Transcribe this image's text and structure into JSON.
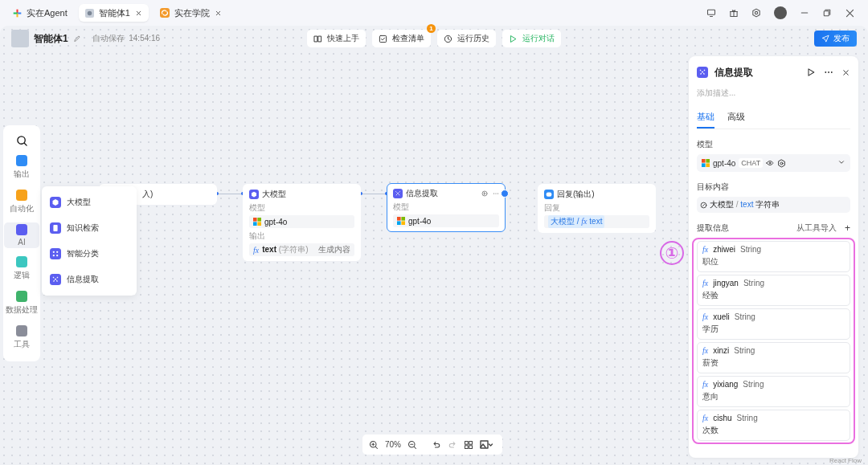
{
  "tabs": [
    {
      "label": "实在Agent",
      "selected": false,
      "closable": false,
      "kind": "agent"
    },
    {
      "label": "智能体1",
      "selected": true,
      "closable": true,
      "kind": "bot"
    },
    {
      "label": "实在学院",
      "selected": false,
      "closable": true,
      "kind": "academy"
    }
  ],
  "header": {
    "title": "智能体1",
    "autosave": "自动保存",
    "time": "14:54:16",
    "actions": [
      {
        "label": "快速上手",
        "kind": "book"
      },
      {
        "label": "检查清单",
        "kind": "check",
        "badge": "1"
      },
      {
        "label": "运行历史",
        "kind": "history"
      },
      {
        "label": "运行对话",
        "kind": "run"
      }
    ],
    "publish": "发布"
  },
  "sidebar": {
    "items": [
      {
        "label": "输出",
        "color": "#2f8cf5",
        "selected": false
      },
      {
        "label": "自动化",
        "color": "#f7a21b",
        "selected": false
      },
      {
        "label": "AI",
        "color": "#5b5ef0",
        "selected": true
      },
      {
        "label": "逻辑",
        "color": "#3cc7c0",
        "selected": false
      },
      {
        "label": "数据处理",
        "color": "#3fb36b",
        "selected": false
      },
      {
        "label": "工具",
        "color": "#8a8d99",
        "selected": false
      }
    ]
  },
  "menu": {
    "items": [
      {
        "label": "大模型",
        "kind": "cube"
      },
      {
        "label": "知识检索",
        "kind": "doc"
      },
      {
        "label": "智能分类",
        "kind": "grid"
      },
      {
        "label": "信息提取",
        "kind": "extract"
      }
    ]
  },
  "nodes": [
    {
      "kind": "start",
      "title": "入)",
      "selected": false
    },
    {
      "kind": "llm",
      "title": "大模型",
      "selected": false,
      "color": "#5b5ef0",
      "model_label": "模型",
      "model": "gpt-4o",
      "output_label": "输出",
      "output": {
        "prefix": "fx",
        "name": "text",
        "type": "(字符串)",
        "note": "生成内容"
      }
    },
    {
      "kind": "extract",
      "title": "信息提取",
      "selected": true,
      "color": "#5b5ef0",
      "model_label": "模型",
      "model": "gpt-4o"
    },
    {
      "kind": "reply",
      "title": "回复(输出)",
      "selected": false,
      "color": "#2f8cf5",
      "reply_label": "回复",
      "source": "大模型",
      "separator": "/",
      "prefix": "fx",
      "var": "text"
    }
  ],
  "zoom": {
    "value": "70%"
  },
  "panel": {
    "title": "信息提取",
    "description_placeholder": "添加描述...",
    "tabs": [
      {
        "label": "基础",
        "selected": true
      },
      {
        "label": "高级",
        "selected": false
      }
    ],
    "model_label": "模型",
    "model": "gpt-4o",
    "model_tag": "CHAT",
    "target_label": "目标内容",
    "target": {
      "source": "大模型",
      "separator": "/",
      "var": "text",
      "type": "字符串"
    },
    "extract_label": "提取信息",
    "import": "从工具导入",
    "add": "+",
    "fields": [
      {
        "prefix": "fx",
        "name": "zhiwei",
        "type": "String",
        "desc": "职位"
      },
      {
        "prefix": "fx",
        "name": "jingyan",
        "type": "String",
        "desc": "经验"
      },
      {
        "prefix": "fx",
        "name": "xueli",
        "type": "String",
        "desc": "学历"
      },
      {
        "prefix": "fx",
        "name": "xinzi",
        "type": "String",
        "desc": "薪资"
      },
      {
        "prefix": "fx",
        "name": "yixiang",
        "type": "String",
        "desc": "意向"
      },
      {
        "prefix": "fx",
        "name": "cishu",
        "type": "String",
        "desc": "次数"
      }
    ]
  },
  "annotation": {
    "label": "①"
  },
  "attribution": "React Flow"
}
